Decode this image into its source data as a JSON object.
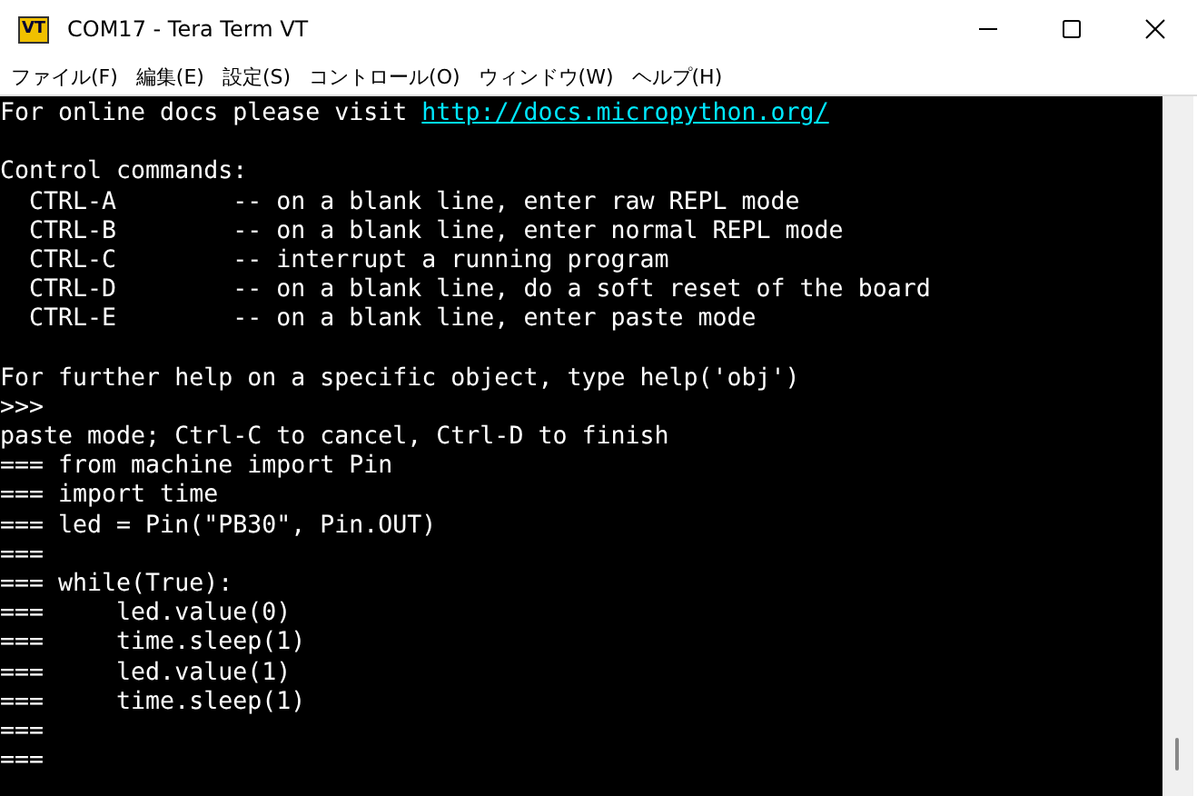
{
  "window": {
    "title": "COM17 - Tera Term VT",
    "app_icon": "VT"
  },
  "menu": [
    "ファイル(F)",
    "編集(E)",
    "設定(S)",
    "コントロール(O)",
    "ウィンドウ(W)",
    "ヘルプ(H)"
  ],
  "terminal": {
    "lines": [
      {
        "kind": "link",
        "text": "For online docs please visit ",
        "link": "http://docs.micropython.org/"
      },
      {
        "kind": "blank"
      },
      {
        "kind": "text",
        "text": "Control commands:"
      },
      {
        "kind": "text",
        "text": "  CTRL-A        -- on a blank line, enter raw REPL mode"
      },
      {
        "kind": "text",
        "text": "  CTRL-B        -- on a blank line, enter normal REPL mode"
      },
      {
        "kind": "text",
        "text": "  CTRL-C        -- interrupt a running program"
      },
      {
        "kind": "text",
        "text": "  CTRL-D        -- on a blank line, do a soft reset of the board"
      },
      {
        "kind": "text",
        "text": "  CTRL-E        -- on a blank line, enter paste mode"
      },
      {
        "kind": "blank"
      },
      {
        "kind": "text",
        "text": "For further help on a specific object, type help('obj')"
      },
      {
        "kind": "text",
        "text": ">>>"
      },
      {
        "kind": "text",
        "text": "paste mode; Ctrl-C to cancel, Ctrl-D to finish"
      },
      {
        "kind": "text",
        "text": "=== from machine import Pin"
      },
      {
        "kind": "text",
        "text": "=== import time"
      },
      {
        "kind": "text",
        "text": "=== led = Pin(\"PB30\", Pin.OUT)"
      },
      {
        "kind": "text",
        "text": "==="
      },
      {
        "kind": "text",
        "text": "=== while(True):"
      },
      {
        "kind": "text",
        "text": "===     led.value(0)"
      },
      {
        "kind": "text",
        "text": "===     time.sleep(1)"
      },
      {
        "kind": "text",
        "text": "===     led.value(1)"
      },
      {
        "kind": "text",
        "text": "===     time.sleep(1)"
      },
      {
        "kind": "text",
        "text": "==="
      },
      {
        "kind": "text",
        "text": "==="
      }
    ]
  }
}
